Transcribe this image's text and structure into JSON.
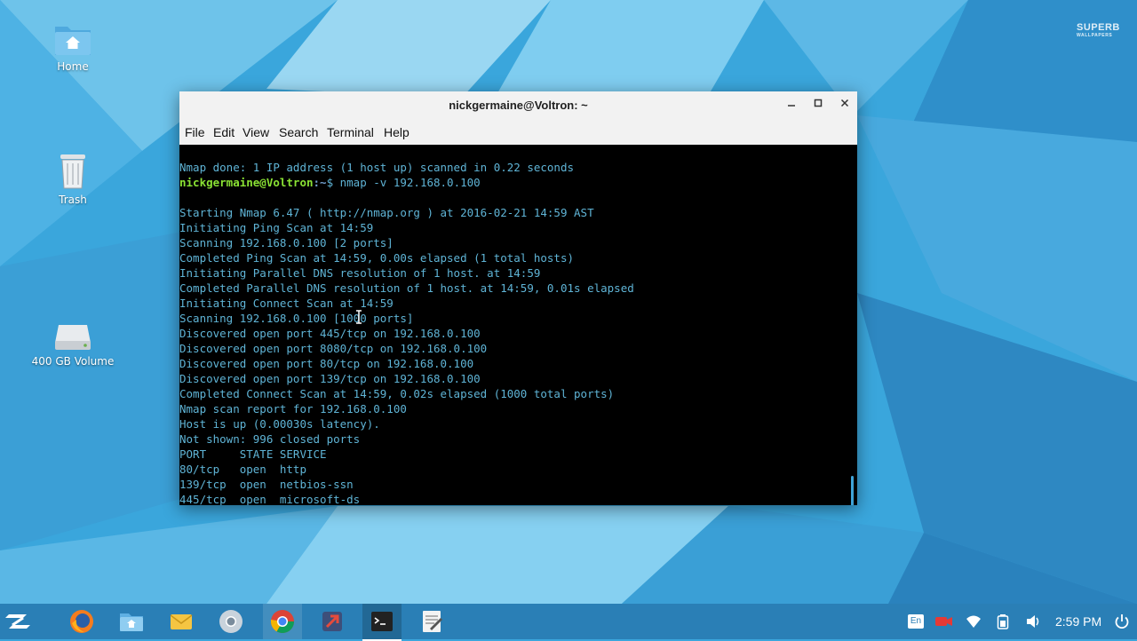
{
  "watermark": {
    "line1": "SUPERB",
    "line2": "WALLPAPERS"
  },
  "desktop": {
    "icons": [
      {
        "name": "home",
        "label": "Home"
      },
      {
        "name": "trash",
        "label": "Trash"
      },
      {
        "name": "volume",
        "label": "400 GB Volume"
      }
    ]
  },
  "terminal": {
    "title": "nickgermaine@Voltron: ~",
    "menu": [
      "File",
      "Edit",
      "View",
      "Search",
      "Terminal",
      "Help"
    ],
    "prompt": {
      "user": "nickgermaine@Voltron",
      "path": ":~",
      "symbol": "$",
      "command": " nmap -v 192.168.0.100"
    },
    "lines_before": [
      "Nmap done: 1 IP address (1 host up) scanned in 0.22 seconds"
    ],
    "lines_after": [
      "",
      "Starting Nmap 6.47 ( http://nmap.org ) at 2016-02-21 14:59 AST",
      "Initiating Ping Scan at 14:59",
      "Scanning 192.168.0.100 [2 ports]",
      "Completed Ping Scan at 14:59, 0.00s elapsed (1 total hosts)",
      "Initiating Parallel DNS resolution of 1 host. at 14:59",
      "Completed Parallel DNS resolution of 1 host. at 14:59, 0.01s elapsed",
      "Initiating Connect Scan at 14:59",
      "Scanning 192.168.0.100 [1000 ports]",
      "Discovered open port 445/tcp on 192.168.0.100",
      "Discovered open port 8080/tcp on 192.168.0.100",
      "Discovered open port 80/tcp on 192.168.0.100",
      "Discovered open port 139/tcp on 192.168.0.100",
      "Completed Connect Scan at 14:59, 0.02s elapsed (1000 total ports)",
      "Nmap scan report for 192.168.0.100",
      "Host is up (0.00030s latency).",
      "Not shown: 996 closed ports",
      "PORT     STATE SERVICE",
      "80/tcp   open  http",
      "139/tcp  open  netbios-ssn",
      "445/tcp  open  microsoft-ds"
    ]
  },
  "taskbar": {
    "apps": [
      "zorin-menu",
      "firefox",
      "files",
      "mail",
      "chromium",
      "chrome",
      "system-tool",
      "terminal",
      "text-editor"
    ],
    "tray": {
      "keyboard": "En"
    },
    "clock": "2:59 PM"
  },
  "colors": {
    "terminal_text": "#5fb4d6",
    "prompt_user": "#8ae234",
    "prompt_path": "#729fcf",
    "taskbar": "#2a7fb6"
  }
}
